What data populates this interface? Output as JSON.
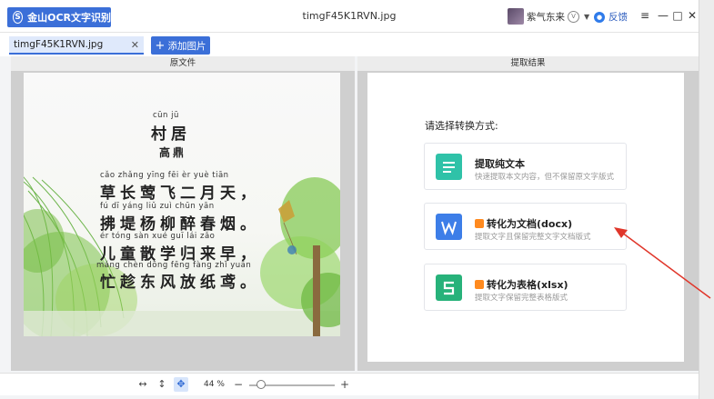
{
  "app": {
    "name": "金山OCR文字识别",
    "window_title": "timgF45K1RVN.jpg",
    "user_name": "紫气东来",
    "feedback": "反馈",
    "accent": "#3b6fd8"
  },
  "tabs": {
    "file_tab": "timgF45K1RVN.jpg",
    "add_button": "添加图片"
  },
  "panels": {
    "source_title": "原文件",
    "result_title": "提取结果"
  },
  "poem": {
    "title_pinyin": "cūn  jū",
    "title": "村居",
    "author": "高鼎",
    "lines": [
      {
        "pinyin": "cǎo zhǎng yīng  fēi   èr   yuè  tiān",
        "text": "草长莺飞二月天，"
      },
      {
        "pinyin": " fú   dī  yáng  liǔ  zuì  chūn yān",
        "text": "拂堤杨柳醉春烟。"
      },
      {
        "pinyin": " ér  tóng sàn  xué  guī  lái  zǎo",
        "text": "儿童散学归来早，"
      },
      {
        "pinyin": "máng chèn dōng fēng fàng zhǐ yuān",
        "text": "忙趁东风放纸鸢。"
      }
    ]
  },
  "result": {
    "prompt": "请选择转换方式:",
    "options": [
      {
        "title": "提取纯文本",
        "desc": "快速提取本文内容，但不保留原文字版式",
        "icon": "text-lines-icon",
        "color": "#2fc2a8"
      },
      {
        "title": "转化为文档(docx)",
        "desc": "提取文字且保留完整文字文档版式",
        "icon": "word-doc-icon",
        "color": "#3d7ee8",
        "vip": true
      },
      {
        "title": "转化为表格(xlsx)",
        "desc": "提取文字保留完整表格版式",
        "icon": "sheet-icon",
        "color": "#27b27a",
        "vip": true
      }
    ]
  },
  "toolbar": {
    "zoom": "44 %",
    "zoom_value_percent": 44,
    "minus": "−",
    "plus": "+"
  }
}
